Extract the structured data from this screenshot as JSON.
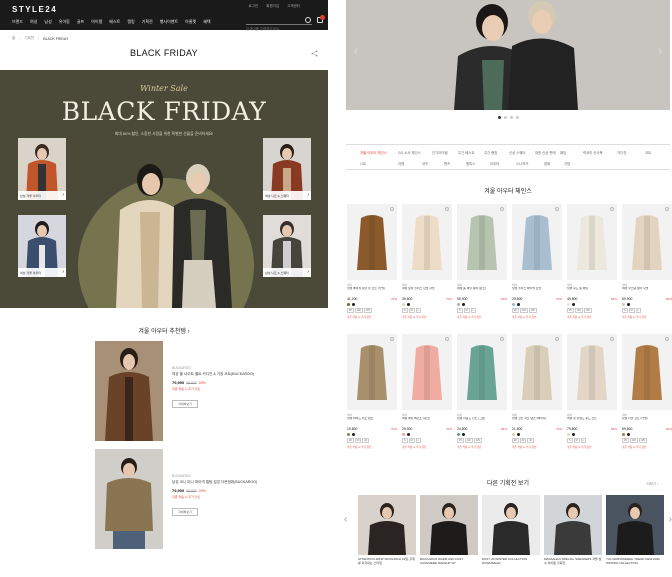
{
  "header": {
    "logo": "STYLE24",
    "utility": [
      "로그인",
      "회원가입",
      "고객센터"
    ],
    "gnb": [
      "브랜드",
      "여성",
      "남성",
      "유아동",
      "골프",
      "아이템",
      "베스트",
      "랭킹",
      "기획전",
      "행사이벤트",
      "아울렛",
      "혜택",
      "아웃렛"
    ],
    "search_placeholder": "검색어를 입력해주세요.",
    "cart_count": ""
  },
  "breadcrumb": [
    "홈",
    "기획전",
    "BLACK FRIDAY"
  ],
  "page_title": "BLACK FRIDAY",
  "hero": {
    "script": "Winter Sale",
    "title": "BLACK FRIDAY",
    "subtitle": "최대 80% 할인, 소중한 사람을 위한 특별한 선물을 준비하세요!",
    "tiles": [
      {
        "caption": "남성 겨울 아우터"
      },
      {
        "caption": "여성 겨울 아우터"
      },
      {
        "caption": "여성 니트 & 스웨터"
      },
      {
        "caption": "남성 니트 & 스웨터"
      }
    ]
  },
  "recommend": {
    "title": "겨울 아우터 추천템 ›",
    "items": [
      {
        "brand": "BUCKAROO",
        "name": "여성 울 나이트 벨트 카디건 & 기장 코트(BUCKAROO)",
        "price": "79,900",
        "original": "99,800",
        "discount": "20%",
        "note": "쿠폰 적용 시 추가 할인",
        "button": "자세히보기"
      },
      {
        "brand": "BUCKAROO",
        "name": "남성 코니 미니 하이넥 퀼팅 집업 다운점퍼(BUCKAROO)",
        "price": "79,900",
        "original": "99,800",
        "discount": "20%",
        "note": "쿠폰 적용 시 추가 할인",
        "button": "자세히보기"
      }
    ]
  },
  "right": {
    "tabs": [
      "겨울 아우터 체인스",
      "GO 소사 체인스",
      "인기아이템",
      "주간 베스트",
      "주간 랭킹",
      "신상 스웨터",
      "대한 신상 판매",
      "패딩",
      "럭셔리 신사복",
      "가디건",
      "코트",
      "니트",
      "자켓",
      "셔츠",
      "팬츠",
      "원피스",
      "아우터",
      "스니커즈",
      "잡화",
      "가방"
    ],
    "section_title": "겨울 아우터 체인스",
    "products": [
      {
        "brand": "제이",
        "name": "남성 베이직 싱글 울 코트 (카멜)",
        "price": "41,200",
        "discount": "75%",
        "colors": [
          "#8a5a2b",
          "#222"
        ],
        "sizes": [
          "95",
          "100",
          "105"
        ],
        "note": "쿠폰 적용 시 추가 할인"
      },
      {
        "brand": "제이",
        "name": "여성 보아 플리스 집업 자켓",
        "price": "39,800",
        "discount": "70%",
        "colors": [
          "#e8d5bf",
          "#222"
        ],
        "sizes": [
          "S",
          "M",
          "L"
        ],
        "note": "쿠폰 적용 시 추가 할인"
      },
      {
        "brand": "제이",
        "name": "여성 숏 패딩 점퍼 (민트)",
        "price": "59,900",
        "discount": "60%",
        "colors": [
          "#a8b8a0",
          "#222"
        ],
        "sizes": [
          "S",
          "M",
          "L"
        ],
        "note": "쿠폰 적용 시 추가 할인"
      },
      {
        "brand": "제이",
        "name": "남성 플리스 하이넥 집업",
        "price": "29,800",
        "discount": "70%",
        "colors": [
          "#9fb6c9",
          "#222"
        ],
        "sizes": [
          "95",
          "100",
          "105"
        ],
        "note": "쿠폰 적용 시 추가 할인"
      },
      {
        "brand": "제이",
        "name": "남성 후드 숏 패딩",
        "price": "49,800",
        "discount": "65%",
        "colors": [
          "#e8e4d8",
          "#222"
        ],
        "sizes": [
          "95",
          "100",
          "105"
        ],
        "note": "쿠폰 적용 시 추가 할인"
      },
      {
        "brand": "제이",
        "name": "여성 무스탕 보아 자켓",
        "price": "69,900",
        "discount": "60%",
        "colors": [
          "#d9c6ae",
          "#222"
        ],
        "sizes": [
          "S",
          "M",
          "L"
        ],
        "note": "쿠폰 적용 시 추가 할인"
      },
      {
        "brand": "제이",
        "name": "남성 와이드 치노 팬츠",
        "price": "19,800",
        "discount": "70%",
        "colors": [
          "#9b7b58",
          "#222"
        ],
        "sizes": [
          "28",
          "30",
          "32"
        ],
        "note": "쿠폰 적용 시 추가 할인"
      },
      {
        "brand": "제이",
        "name": "여성 패딩 베스트 (핑크)",
        "price": "29,900",
        "discount": "70%",
        "colors": [
          "#f0a79a",
          "#222"
        ],
        "sizes": [
          "S",
          "M",
          "L"
        ],
        "note": "쿠폰 적용 시 추가 할인"
      },
      {
        "brand": "제이",
        "name": "남성 라운드 니트 (그린)",
        "price": "24,800",
        "discount": "65%",
        "colors": [
          "#5f9c8c",
          "#222"
        ],
        "sizes": [
          "95",
          "100",
          "105"
        ],
        "note": "쿠폰 적용 시 추가 할인"
      },
      {
        "brand": "제이",
        "name": "남성 코튼 치노 팬츠 (베이지)",
        "price": "21,800",
        "discount": "70%",
        "colors": [
          "#d8cdb4",
          "#222"
        ],
        "sizes": [
          "28",
          "30",
          "32"
        ],
        "note": "쿠폰 적용 시 추가 할인"
      },
      {
        "brand": "제이",
        "name": "여성 울 블렌드 후드 코트",
        "price": "79,800",
        "discount": "65%",
        "colors": [
          "#e5d8c8",
          "#222"
        ],
        "sizes": [
          "S",
          "M",
          "L"
        ],
        "note": "쿠폰 적용 시 추가 할인"
      },
      {
        "brand": "제이",
        "name": "남성 더플 코트 (카멜)",
        "price": "89,800",
        "discount": "60%",
        "colors": [
          "#b07a45",
          "#222"
        ],
        "sizes": [
          "95",
          "100",
          "105"
        ],
        "note": "쿠폰 적용 시 추가 할인"
      }
    ],
    "other_title": "다른 기획전 보기",
    "more": "더보기 ›",
    "events": [
      {
        "caption": "ATTENTION 20FW WOOLRICH 12월, 추위를 이겨내는 스타일"
      },
      {
        "caption": "BUCKAROO WARM AND FURY CASHMERE MAKEUP UP"
      },
      {
        "caption": "DKNY 20 WINTER COLLECTION DOWNWEAR"
      },
      {
        "caption": "MASSAHAN SPECIAL SNEAKERS 겨울 필수 아이템 기획전"
      },
      {
        "caption": "YOU EMPOWERED TREND NEW 2020 WINTER COLLECTION"
      }
    ]
  }
}
